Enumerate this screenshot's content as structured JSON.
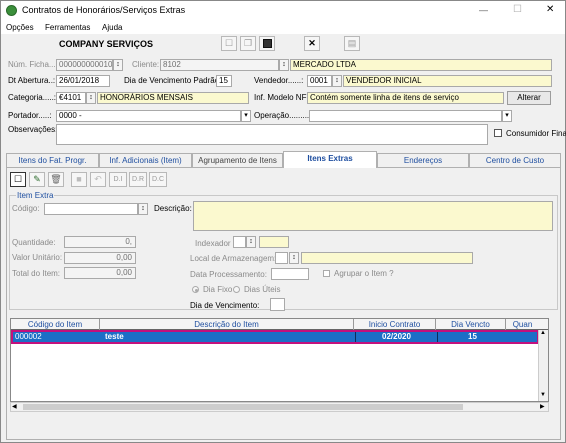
{
  "window": {
    "title": "Contratos de Honorários/Serviços Extras",
    "min": "—",
    "max": "☐",
    "close": "✕"
  },
  "menu": {
    "items": [
      "Opções",
      "Ferramentas",
      "Ajuda"
    ]
  },
  "header": {
    "company": "COMPANY SERVIÇOS"
  },
  "toolbar": {
    "new": "☐",
    "copy": "❐",
    "save": "💾",
    "delete": "✕",
    "print": "▤"
  },
  "form": {
    "num_ficha_label": "Núm. Ficha....:",
    "num_ficha_value": "000000000010",
    "cliente_label": "Cliente:",
    "cliente_code": "8102",
    "cliente_name": "MERCADO LTDA",
    "dt_abertura_label": "Dt Abertura..:",
    "dt_abertura_value": "26/01/2018",
    "dia_venc_label": "Dia de Vencimento Padrão:",
    "dia_venc_value": "15",
    "vendedor_label": "Vendedor......:",
    "vendedor_code": "0001",
    "vendedor_name": "VENDEDOR INICIAL",
    "categoria_label": "Categoria.....:",
    "categoria_code": "€4101",
    "categoria_name": "HONORÁRIOS MENSAIS",
    "inf_modelo_label": "Inf. Modelo NF:",
    "inf_modelo_value": "Contém somente linha de itens de serviço",
    "alterar_label": "Alterar",
    "portador_label": "Portador.....:",
    "portador_value": "0000 -",
    "operacao_label": "Operação.........:",
    "operacao_value": "",
    "observacoes_label": "Observações:",
    "observacoes_value": "",
    "consumidor_label": "Consumidor Final"
  },
  "tabs": [
    "Itens do Fat. Progr.",
    "Inf. Adicionais (Item)",
    "Agrupamento de Itens",
    "Itens Extras",
    "Endereços",
    "Centro de Custo"
  ],
  "panel": {
    "tool": {
      "undo": "↶",
      "di": "D.I",
      "dr": "D.R",
      "dc": "D.C"
    },
    "group_title": "Item Extra",
    "codigo_label": "Código:",
    "codigo_value": "",
    "descricao_label": "Descrição:",
    "descricao_value": "",
    "quantidade_label": "Quantidade:",
    "quantidade_value": "0,",
    "valor_unit_label": "Valor Unitário:",
    "valor_unit_value": "0,00",
    "total_label": "Total do Item:",
    "total_value": "0,00",
    "indexador_label": "Indexador",
    "local_label": "Local de Armazenagem:",
    "data_proc_label": "Data Processamento:",
    "agrupar_label": "Agrupar o Item ?",
    "dia_fixo_label": "Dia Fixo",
    "dias_uteis_label": "Dias Úteis",
    "dia_venc_label": "Dia de Vencimento:"
  },
  "grid": {
    "headers": [
      "Código do Item",
      "Descrição do Item",
      "Inicio Contrato",
      "Dia Vencto",
      "Quan"
    ],
    "rows": [
      {
        "codigo": "000002",
        "descricao": "teste",
        "inicio": "02/2020",
        "dia": "15"
      }
    ]
  }
}
